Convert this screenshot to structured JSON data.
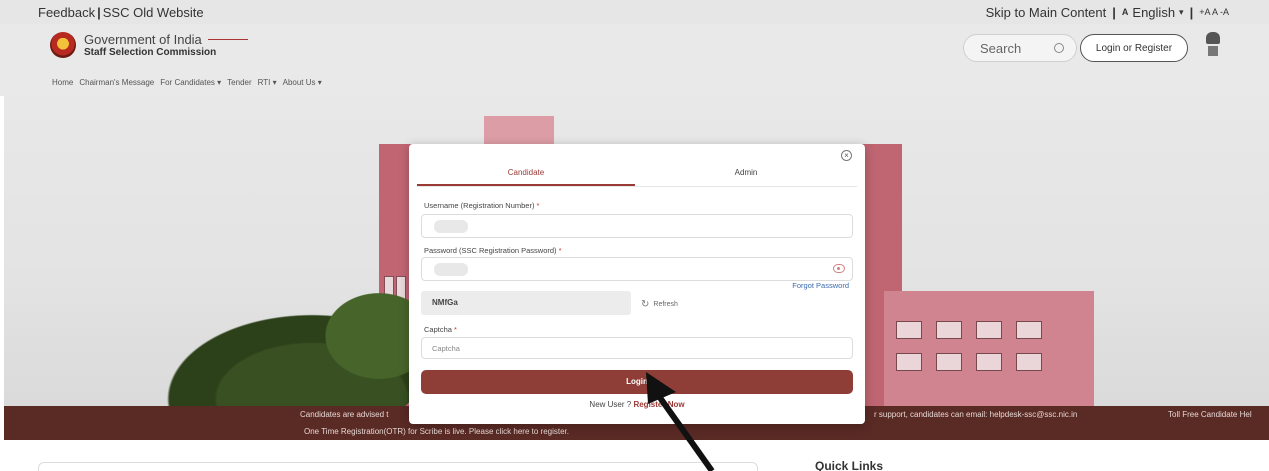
{
  "topbar": {
    "feedback": "Feedback",
    "old_site": "SSC Old Website",
    "skip": "Skip to Main Content",
    "language": "English",
    "font_controls": "+A A -A"
  },
  "header": {
    "gov": "Government of India",
    "org": "Staff Selection Commission",
    "search_placeholder": "Search",
    "login_register": "Login or Register"
  },
  "nav": [
    "Home",
    "Chairman's Message",
    "For Candidates ▾",
    "Tender",
    "RTI ▾",
    "About Us ▾"
  ],
  "notice": {
    "line1_left": "Candidates are advised t",
    "line1_mid": "r support, candidates can email: helpdesk-ssc@ssc.nic.in",
    "line1_right": "Toll Free Candidate Hel",
    "line2": "One Time Registration(OTR) for Scribe is live. Please click here to register."
  },
  "quick_links": "Quick Links",
  "modal": {
    "close": "×",
    "tab_candidate": "Candidate",
    "tab_admin": "Admin",
    "username_label": "Username (Registration Number)",
    "password_label": "Password (SSC Registration Password)",
    "required_mark": "*",
    "forgot": "Forgot Password",
    "captcha_code": "NMfGa",
    "refresh": "Refresh",
    "captcha_label": "Captcha",
    "captcha_placeholder": "Captcha",
    "login": "Login",
    "new_user": "New User ?",
    "register": "Register Now"
  },
  "colors": {
    "brand": "#8e3e37",
    "notice_bg": "#5a2a25",
    "link": "#3a6bb0"
  }
}
